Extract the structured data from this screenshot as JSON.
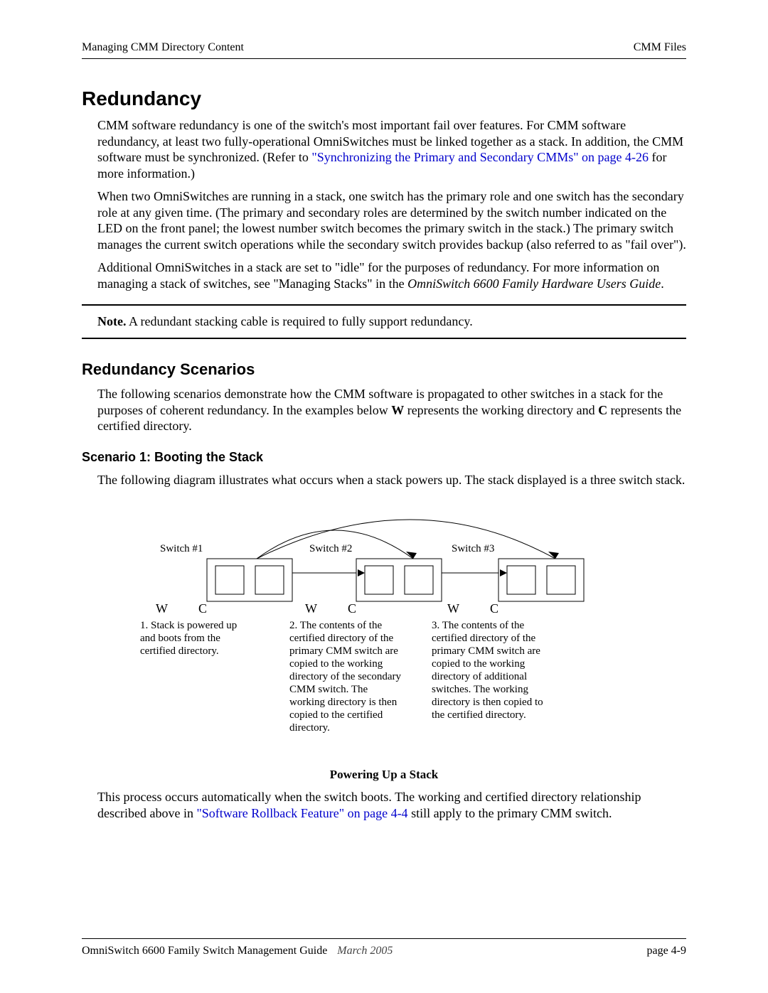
{
  "header": {
    "left": "Managing CMM Directory Content",
    "right": "CMM Files"
  },
  "section_title": "Redundancy",
  "para1_pre": "CMM software redundancy is one of the switch's most important fail over features. For CMM software redundancy, at least two fully-operational OmniSwitches must be linked together as a stack. In addition, the CMM software must be synchronized. (Refer to ",
  "para1_link": "\"Synchronizing the Primary and Secondary CMMs\" on page 4-26",
  "para1_post": " for more information.)",
  "para2": "When two OmniSwitches are running in a stack, one switch has the primary role and one switch has the secondary role at any given time. (The primary and secondary roles are determined by the switch number indicated on the LED on the front panel; the lowest number switch becomes the primary switch in the stack.) The primary switch manages the current switch operations while the secondary switch provides backup (also referred to as \"fail over\").",
  "para3_pre": "Additional OmniSwitches in a stack are set to \"idle\" for the purposes of redundancy. For more information on managing a stack of switches, see \"Managing Stacks\" in the ",
  "para3_italic": "OmniSwitch 6600 Family Hardware Users Guide",
  "para3_post": ".",
  "note_label": "Note.",
  "note_text": " A redundant stacking cable is required to fully support redundancy.",
  "subsection_title": "Redundancy Scenarios",
  "para4_pre": "The following scenarios demonstrate how the CMM software is propagated to other switches in a stack for the purposes of coherent redundancy. In the examples below ",
  "para4_bold1": "W",
  "para4_mid": " represents the working directory and ",
  "para4_bold2": "C",
  "para4_post": " represents the certified directory.",
  "scenario_title": "Scenario 1: Booting the Stack",
  "para5": "The following diagram illustrates what occurs when a stack powers up. The stack displayed is a three switch stack.",
  "diagram": {
    "switch1_label": "Switch #1",
    "switch2_label": "Switch #2",
    "switch3_label": "Switch #3",
    "W": "W",
    "C": "C",
    "caption1": "1. Stack is powered up and boots from the certified directory.",
    "caption2": "2. The contents of the certified directory of the primary CMM switch are copied to the working directory of the secondary CMM switch. The working directory is then copied to the certified directory.",
    "caption3": "3. The contents of the certified directory of the primary CMM switch are copied to the working directory of additional switches. The working directory is then copied to the certified directory.",
    "figure_title": "Powering Up a Stack"
  },
  "para6_pre": "This process occurs automatically when the switch boots. The working and certified directory relationship described above in ",
  "para6_link": "\"Software Rollback Feature\" on page 4-4",
  "para6_post": " still apply to the primary CMM switch.",
  "footer": {
    "guide": "OmniSwitch 6600 Family Switch Management Guide",
    "date": "March 2005",
    "page": "page 4-9"
  }
}
